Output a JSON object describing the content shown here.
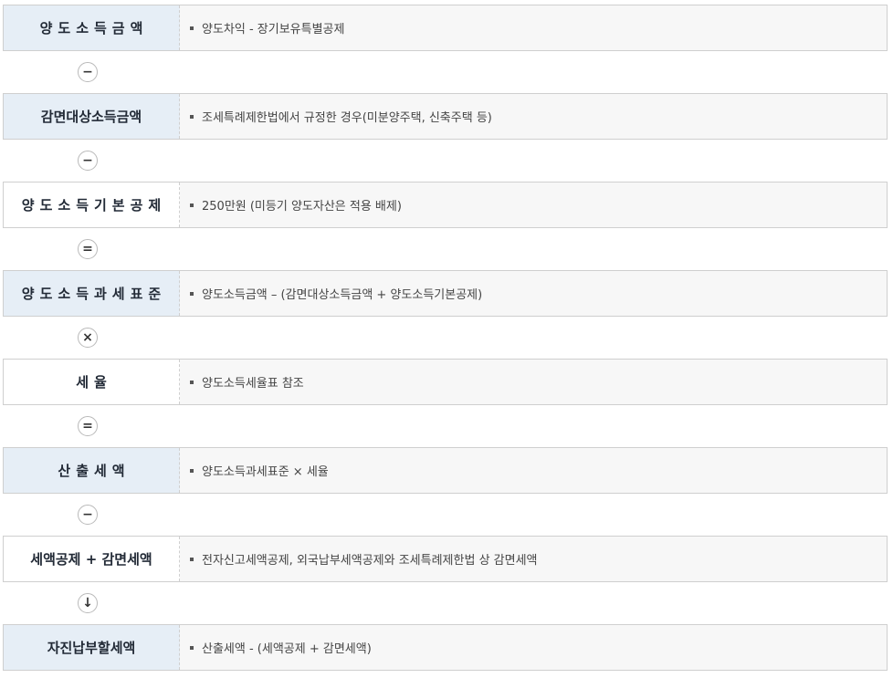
{
  "rows": [
    {
      "label": "양도소득금액",
      "desc": "양도차익 - 장기보유특별공제"
    },
    {
      "label": "감면대상소득금액",
      "desc": "조세특례제한법에서 규정한 경우(미분양주택, 신축주택 등)"
    },
    {
      "label": "양도소득기본공제",
      "desc": "250만원 (미등기 양도자산은 적용 배제)"
    },
    {
      "label": "양도소득과세표준",
      "desc": "양도소득금액 – (감면대상소득금액 + 양도소득기본공제)"
    },
    {
      "label": "세율",
      "desc": "양도소득세율표 참조"
    },
    {
      "label": "산출세액",
      "desc": "양도소득과세표준 × 세율"
    },
    {
      "label": "세액공제 + 감면세액",
      "desc": "전자신고세액공제, 외국납부세액공제와 조세특례제한법 상 감면세액"
    },
    {
      "label": "자진납부할세액",
      "desc": "산출세액 - (세액공제 + 감면세액)"
    }
  ],
  "operators": [
    {
      "name": "minus-icon",
      "symbol": "−"
    },
    {
      "name": "minus-icon",
      "symbol": "−"
    },
    {
      "name": "equals-icon",
      "symbol": "="
    },
    {
      "name": "multiply-icon",
      "symbol": "×"
    },
    {
      "name": "equals-icon",
      "symbol": "="
    },
    {
      "name": "minus-icon",
      "symbol": "−"
    },
    {
      "name": "arrow-down-icon",
      "symbol": "↓"
    }
  ],
  "colors": {
    "label_bg_highlight": "#e6eef6",
    "label_bg_plain": "#ffffff",
    "row_bg": "#f7f7f7",
    "border": "#cfcfcf",
    "label_text": "#222a36"
  }
}
